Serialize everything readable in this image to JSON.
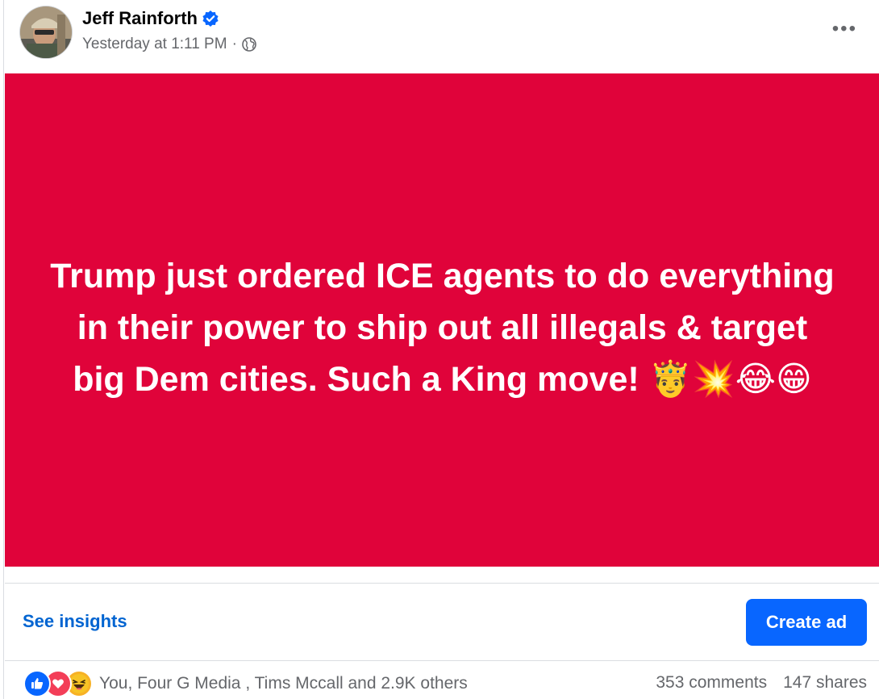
{
  "post": {
    "author": "Jeff Rainforth",
    "timestamp": "Yesterday at 1:11 PM",
    "separator": "·",
    "body_text": "Trump just ordered ICE agents to do everything in their power to ship out all illegals & target big Dem cities. Such a King move! 🤴💥😂😁",
    "more_label": "•••"
  },
  "actions": {
    "insights_label": "See insights",
    "create_ad_label": "Create ad"
  },
  "engagement": {
    "reactions_text": "You, Four G Media , Tims Mccall and 2.9K others",
    "comments": "353 comments",
    "shares": "147 shares",
    "reaction_icons": [
      "like-icon",
      "love-icon",
      "haha-icon"
    ]
  },
  "colors": {
    "banner_bg": "#e0033a",
    "primary_blue": "#0866ff",
    "link_blue": "#0064d1",
    "secondary_text": "#65676b"
  }
}
